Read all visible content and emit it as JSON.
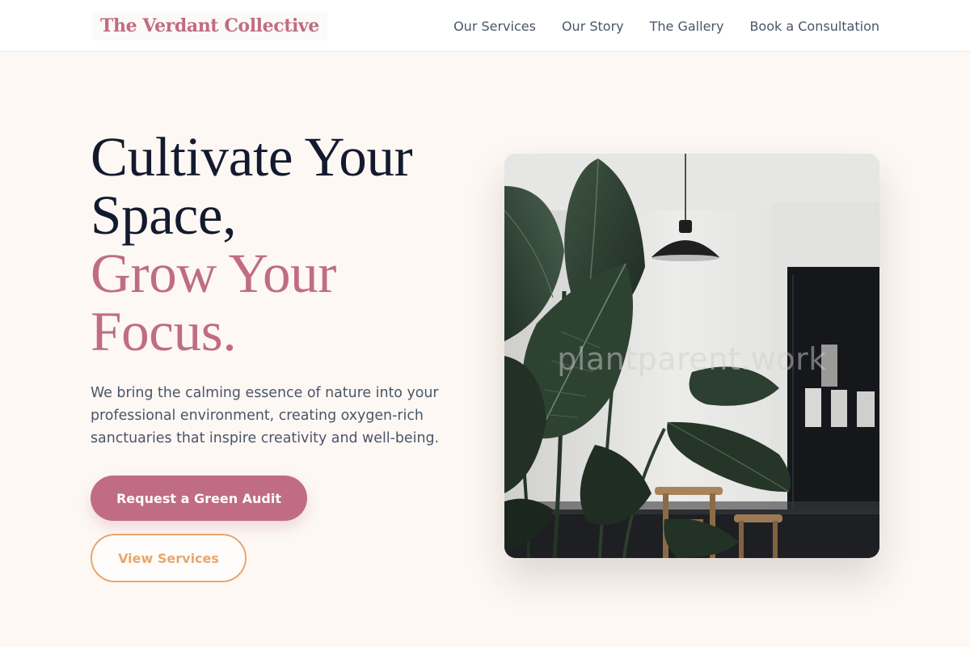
{
  "header": {
    "brand": "The Verdant Collective",
    "nav": [
      "Our Services",
      "Our Story",
      "The Gallery",
      "Book a Consultation"
    ]
  },
  "hero": {
    "title_line1": "Cultivate Your Space,",
    "title_line2": "Grow Your Focus.",
    "description": "We bring the calming essence of nature into your professional environment, creating oxygen-rich sanctuaries that inspire creativity and well-being.",
    "primary_cta": "Request a Green Audit",
    "secondary_cta": "View Services",
    "image": {
      "subject": "large-leaf indoor plant beside a pendant lamp in a bright interior",
      "watermark": "plantparent.work"
    }
  },
  "colors": {
    "brand_rose": "#c06c84",
    "accent_orange": "#e8a66e",
    "heading_navy": "#141a2e",
    "body_text": "#4a5568",
    "page_background": "#fdf8f4"
  }
}
